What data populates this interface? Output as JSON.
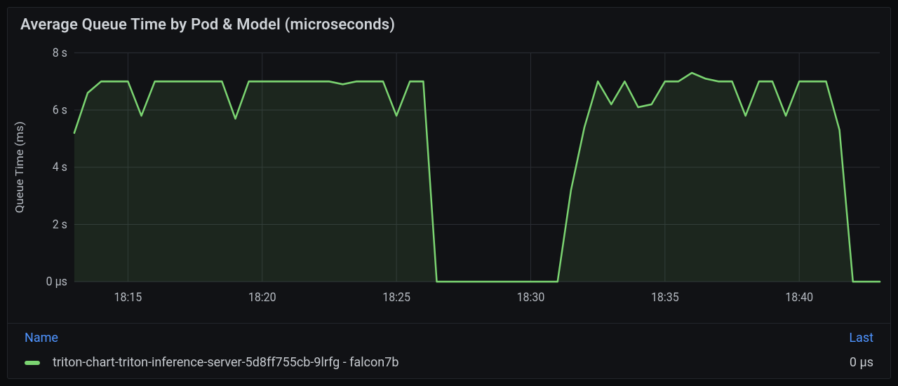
{
  "panel": {
    "title": "Average Queue Time by Pod & Model (microseconds)"
  },
  "legend": {
    "header_name": "Name",
    "header_last": "Last",
    "rows": [
      {
        "label": "triton-chart-triton-inference-server-5d8ff755cb-9lrfg - falcon7b",
        "last": "0 μs",
        "color": "#7bd471"
      }
    ]
  },
  "chart_data": {
    "type": "line",
    "title": "Average Queue Time by Pod & Model (microseconds)",
    "xlabel": "",
    "ylabel": "Queue Time (ms)",
    "y_ticks": [
      "0 µs",
      "2 s",
      "4 s",
      "6 s",
      "8 s"
    ],
    "ylim": [
      0,
      8
    ],
    "x_ticks": [
      "18:15",
      "18:20",
      "18:25",
      "18:30",
      "18:35",
      "18:40"
    ],
    "x_range": [
      "18:13",
      "18:43"
    ],
    "series": [
      {
        "name": "triton-chart-triton-inference-server-5d8ff755cb-9lrfg - falcon7b",
        "color": "#7bd471",
        "x": [
          "18:13.0",
          "18:13.5",
          "18:14.0",
          "18:14.5",
          "18:15.0",
          "18:15.5",
          "18:16.0",
          "18:16.5",
          "18:17.0",
          "18:17.5",
          "18:18.0",
          "18:18.5",
          "18:19.0",
          "18:19.5",
          "18:20.0",
          "18:20.5",
          "18:21.0",
          "18:21.5",
          "18:22.0",
          "18:22.5",
          "18:23.0",
          "18:23.5",
          "18:24.0",
          "18:24.5",
          "18:25.0",
          "18:25.5",
          "18:26.0",
          "18:26.5",
          "18:27.0",
          "18:27.5",
          "18:28.0",
          "18:28.5",
          "18:29.0",
          "18:29.5",
          "18:30.0",
          "18:30.5",
          "18:31.0",
          "18:31.5",
          "18:32.0",
          "18:32.5",
          "18:33.0",
          "18:33.5",
          "18:34.0",
          "18:34.5",
          "18:35.0",
          "18:35.5",
          "18:36.0",
          "18:36.5",
          "18:37.0",
          "18:37.5",
          "18:38.0",
          "18:38.5",
          "18:39.0",
          "18:39.5",
          "18:40.0",
          "18:40.5",
          "18:41.0",
          "18:41.5",
          "18:42.0",
          "18:42.5",
          "18:43.0"
        ],
        "y": [
          5.2,
          6.6,
          7.0,
          7.0,
          7.0,
          5.8,
          7.0,
          7.0,
          7.0,
          7.0,
          7.0,
          7.0,
          5.7,
          7.0,
          7.0,
          7.0,
          7.0,
          7.0,
          7.0,
          7.0,
          6.9,
          7.0,
          7.0,
          7.0,
          5.8,
          7.0,
          7.0,
          0.0,
          0.0,
          0.0,
          0.0,
          0.0,
          0.0,
          0.0,
          0.0,
          0.0,
          0.0,
          3.2,
          5.4,
          7.0,
          6.2,
          7.0,
          6.1,
          6.2,
          7.0,
          7.0,
          7.3,
          7.1,
          7.0,
          7.0,
          5.8,
          7.0,
          7.0,
          5.8,
          7.0,
          7.0,
          7.0,
          5.3,
          0.0,
          0.0,
          0.0
        ]
      }
    ]
  }
}
